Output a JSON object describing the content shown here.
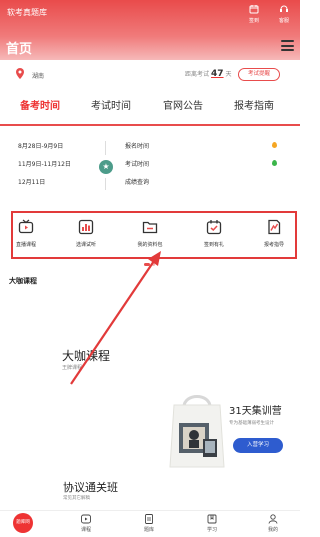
{
  "app": {
    "title": "软考真题库",
    "signin_label": "签到",
    "service_label": "客服"
  },
  "header": {
    "page_title": "首页"
  },
  "location": {
    "province": "湖南",
    "countdown_prefix": "距离考试",
    "countdown_days": "47",
    "countdown_suffix": "天",
    "countdown_button": "考试提醒"
  },
  "tabs": [
    {
      "label": "备考时间",
      "active": true
    },
    {
      "label": "考试时间",
      "active": false
    },
    {
      "label": "官网公告",
      "active": false
    },
    {
      "label": "报考指南",
      "active": false
    }
  ],
  "schedule": [
    {
      "date": "8月28日-9月9日",
      "event": "报名时间",
      "dot_color": "#f5a623"
    },
    {
      "date": "11月9日-11月12日",
      "event": "考试时间",
      "dot_color": "#3bb54a"
    },
    {
      "date": "12月11日",
      "event": "成绩查询",
      "dot_color": ""
    }
  ],
  "quick_links": [
    {
      "label": "直播课程",
      "icon": "tv-icon"
    },
    {
      "label": "选课试听",
      "icon": "chart-icon"
    },
    {
      "label": "我的资料包",
      "icon": "folder-icon"
    },
    {
      "label": "签到有礼",
      "icon": "calendar-check-icon"
    },
    {
      "label": "报考指导",
      "icon": "report-icon"
    }
  ],
  "section": {
    "title": "大咖课程"
  },
  "cards": {
    "a": {
      "title": "大咖课程",
      "subtitle": "王牌课程"
    },
    "b": {
      "title": "31天集训营",
      "subtitle": "专为基础薄弱考生设计",
      "button": "入营学习"
    },
    "c": {
      "title": "协议通关班",
      "subtitle": "常见其它解稿"
    }
  },
  "bottom_nav": [
    {
      "label": "题库网",
      "active": true
    },
    {
      "label": "课程",
      "active": false
    },
    {
      "label": "题库",
      "active": false
    },
    {
      "label": "学习",
      "active": false
    },
    {
      "label": "我的",
      "active": false
    }
  ],
  "colors": {
    "brand_red": "#e84c4c",
    "highlight_border": "#e23a3a",
    "cta_blue": "#2e5ccf"
  }
}
